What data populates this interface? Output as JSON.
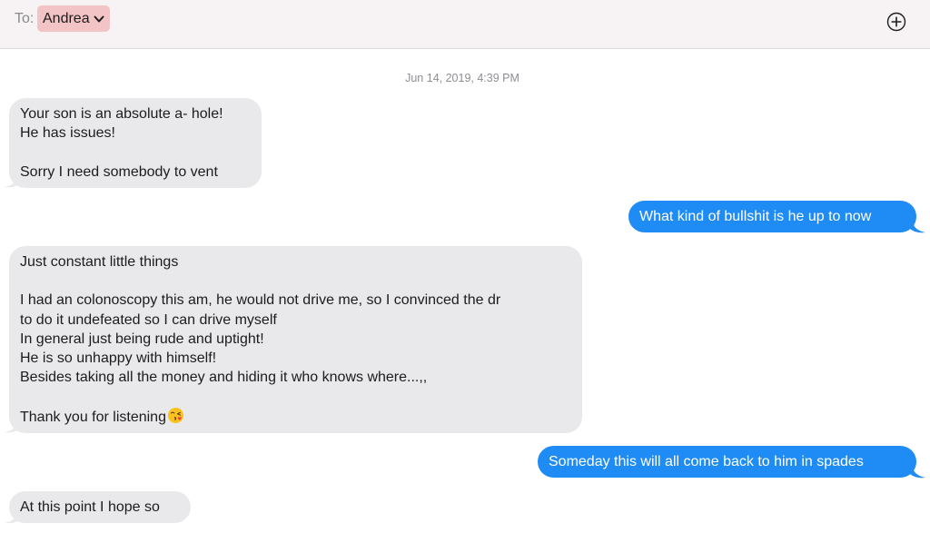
{
  "header": {
    "to_label": "To:",
    "recipient": "Andrea",
    "chevron_icon": "chevron-down-icon",
    "add_icon": "plus-circle-icon"
  },
  "conversation": {
    "timestamp": "Jun 14, 2019, 4:39 PM",
    "colors": {
      "incoming_bubble": "#e9e9eb",
      "outgoing_bubble": "#1f8cf5",
      "header_bg": "#f7f3f4",
      "recipient_chip": "#f3c4c5"
    },
    "messages": [
      {
        "direction": "incoming",
        "lines": [
          "Your son is an absolute a- hole!",
          "He has issues!",
          "",
          "Sorry I need somebody to vent"
        ]
      },
      {
        "direction": "outgoing",
        "lines": [
          "What kind of bullshit is he up to now"
        ]
      },
      {
        "direction": "incoming",
        "lines": [
          "Just constant little things",
          "",
          "I had an colonoscopy this am, he would not drive me, so I convinced the dr",
          "to do it undefeated so I can drive myself",
          "In general just being rude and uptight!",
          "He is so unhappy with himself!",
          "Besides taking all the money and hiding it who knows where...,,",
          "",
          "Thank you for listening"
        ],
        "trailing_emoji": "kissing-face-emoji"
      },
      {
        "direction": "outgoing",
        "lines": [
          "Someday this will all come back to him in spades"
        ]
      },
      {
        "direction": "incoming",
        "lines": [
          "At this point I hope so"
        ]
      }
    ]
  }
}
